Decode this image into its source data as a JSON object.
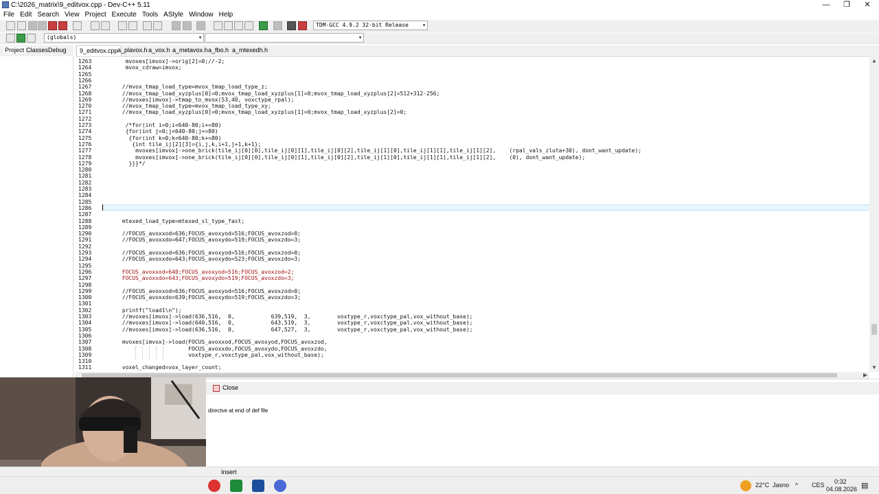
{
  "window": {
    "title": "C:\\2026_matrix\\9_editvox.cpp - Dev-C++ 5.11",
    "minimize": "—",
    "restore": "❐",
    "close": "✕"
  },
  "menu": [
    "File",
    "Edit",
    "Search",
    "View",
    "Project",
    "Execute",
    "Tools",
    "AStyle",
    "Window",
    "Help"
  ],
  "toolbar": {
    "compiler": "TDM-GCC 4.9.2 32-bit Release",
    "scope": "(globals)"
  },
  "left_tabs": [
    "Project",
    "Classes",
    "Debug"
  ],
  "file_tabs": [
    "9_editvox.cpp",
    "a_plavox.h",
    "a_vox.h",
    "a_metavox.h",
    "a_fbo.h",
    "a_mtexedh.h"
  ],
  "code": [
    {
      "n": "1263",
      "t": "mvoxes[imvox]->orig[2]=0;//-2;",
      "i": 7
    },
    {
      "n": "1264",
      "t": "mvox_cdraw=imvox;",
      "i": 7
    },
    {
      "n": "1265",
      "t": "",
      "i": 0
    },
    {
      "n": "1266",
      "t": "",
      "i": 0
    },
    {
      "n": "1267",
      "t": "//mvox_tmap_load_type=mvox_tmap_load_type_z;",
      "i": 6
    },
    {
      "n": "1268",
      "t": "//mvox_tmap_load_xyzplus[0]=0;mvox_tmap_load_xyzplus[1]=0;mvox_tmap_load_xyzplus[2]=512+312-256;",
      "i": 6
    },
    {
      "n": "1269",
      "t": "//mvoxes[imvox]->tmap_to_mvox(53,40, voxctype_rpal);",
      "i": 6
    },
    {
      "n": "1270",
      "t": "//mvox_tmap_load_type=mvox_tmap_load_type_xy;",
      "i": 6
    },
    {
      "n": "1271",
      "t": "//mvox_tmap_load_xyzplus[0]=0;mvox_tmap_load_xyzplus[1]=0;mvox_tmap_load_xyzplus[2]=0;",
      "i": 6
    },
    {
      "n": "1272",
      "t": "",
      "i": 0
    },
    {
      "n": "1273",
      "t": "/*for(int i=0;i<640-80;i+=80)",
      "i": 7
    },
    {
      "n": "1274",
      "t": "{for(int j=0;j<640-80;j+=80)",
      "i": 7
    },
    {
      "n": "1275",
      "t": " {for(int k=0;k<640-80;k+=80)",
      "i": 7
    },
    {
      "n": "1276",
      "t": "  {int tile_ij[2][3]={i,j,k,i+1,j+1,k+1};",
      "i": 7
    },
    {
      "n": "1277",
      "t": "   mvoxes[imvox]->one_brick(tile_ij[0][0],tile_ij[0][1],tile_ij[0][2],tile_ij[1][0],tile_ij[1][1],tile_ij[1][2],    (rpal_vals_zluta+30), dont_want_update);",
      "i": 7
    },
    {
      "n": "1278",
      "t": "   mvoxes[imvox]->one_brick(tile_ij[0][0],tile_ij[0][1],tile_ij[0][2],tile_ij[1][0],tile_ij[1][1],tile_ij[1][2],    (0), dont_want_update);",
      "i": 7
    },
    {
      "n": "1279",
      "t": " }}}*/",
      "i": 7
    },
    {
      "n": "1280",
      "t": "",
      "i": 0
    },
    {
      "n": "1281",
      "t": "",
      "i": 0
    },
    {
      "n": "1282",
      "t": "",
      "i": 0
    },
    {
      "n": "1283",
      "t": "",
      "i": 0
    },
    {
      "n": "1284",
      "t": "",
      "i": 0
    },
    {
      "n": "1285",
      "t": "",
      "i": 0
    },
    {
      "n": "1286",
      "t": "",
      "i": 0
    },
    {
      "n": "1287",
      "t": "",
      "i": 0
    },
    {
      "n": "1288",
      "t": "mtexed_load_type=mtexed_sl_type_fast;",
      "i": 6
    },
    {
      "n": "1289",
      "t": "",
      "i": 0
    },
    {
      "n": "1290",
      "t": "//FOCUS_avoxxod=636;FOCUS_avoxyod=516;FOCUS_avoxzod=0;",
      "i": 6
    },
    {
      "n": "1291",
      "t": "//FOCUS_avoxxdo=647;FOCUS_avoxydo=519;FOCUS_avoxzdo=3;",
      "i": 6
    },
    {
      "n": "1292",
      "t": "",
      "i": 0
    },
    {
      "n": "1293",
      "t": "//FOCUS_avoxxod=636;FOCUS_avoxyod=516;FOCUS_avoxzod=0;",
      "i": 6
    },
    {
      "n": "1294",
      "t": "//FOCUS_avoxxdo=643;FOCUS_avoxydo=523;FOCUS_avoxzdo=3;",
      "i": 6
    },
    {
      "n": "1295",
      "t": "",
      "i": 0
    },
    {
      "n": "1296",
      "t": "FOCUS_avoxxod=640;FOCUS_avoxyod=516;FOCUS_avoxzod=2;",
      "i": 6
    },
    {
      "n": "1297",
      "t": "FOCUS_avoxxdo=643;FOCUS_avoxydo=519;FOCUS_avoxzdo=3;",
      "i": 6
    },
    {
      "n": "1298",
      "t": "",
      "i": 0
    },
    {
      "n": "1299",
      "t": "//FOCUS_avoxxod=636;FOCUS_avoxyod=516;FOCUS_avoxzod=0;",
      "i": 6
    },
    {
      "n": "1300",
      "t": "//FOCUS_avoxxdo=639;FOCUS_avoxydo=519;FOCUS_avoxzdo=3;",
      "i": 6
    },
    {
      "n": "1301",
      "t": "",
      "i": 0
    },
    {
      "n": "1302",
      "t": "printf(\"load1\\n\");",
      "i": 6
    },
    {
      "n": "1303",
      "t": "//mvoxes[imvox]->load(636,516,  0,           639,519,  3,        voxtype_r,voxctype_pal,vox_without_base);",
      "i": 6
    },
    {
      "n": "1304",
      "t": "//mvoxes[imvox]->load(640,516,  0,           643,519,  3,        voxtype_r,voxctype_pal,vox_without_base);",
      "i": 6
    },
    {
      "n": "1305",
      "t": "//mvoxes[imvox]->load(636,516,  0,           647,527,  3,        voxtype_r,voxctype_pal,vox_without_base);",
      "i": 6
    },
    {
      "n": "1306",
      "t": "",
      "i": 0
    },
    {
      "n": "1307",
      "t": "mvoxes[imvox]->load(FOCUS_avoxxod,FOCUS_avoxyod,FOCUS_avoxzod,",
      "i": 6
    },
    {
      "n": "1308",
      "t": "                    FOCUS_avoxxdo,FOCUS_avoxydo,FOCUS_avoxzdo,",
      "i": 6
    },
    {
      "n": "1309",
      "t": "                    voxtype_r,voxctype_pal,vox_without_base);",
      "i": 6
    },
    {
      "n": "1310",
      "t": "",
      "i": 0
    },
    {
      "n": "1311",
      "t": "voxel_changed=vox_layer_count;",
      "i": 6
    }
  ],
  "bottom": {
    "close_label": "Close",
    "message": "directve at end of def file"
  },
  "status": {
    "mode": "Insert"
  },
  "tray": {
    "temperature": "22°C",
    "weather": "Jasno",
    "language": "CES",
    "time": "0:32",
    "date": "04.08.2026"
  },
  "colors": {
    "current_line": "#e8f7ff",
    "accent": "#0078d4"
  }
}
